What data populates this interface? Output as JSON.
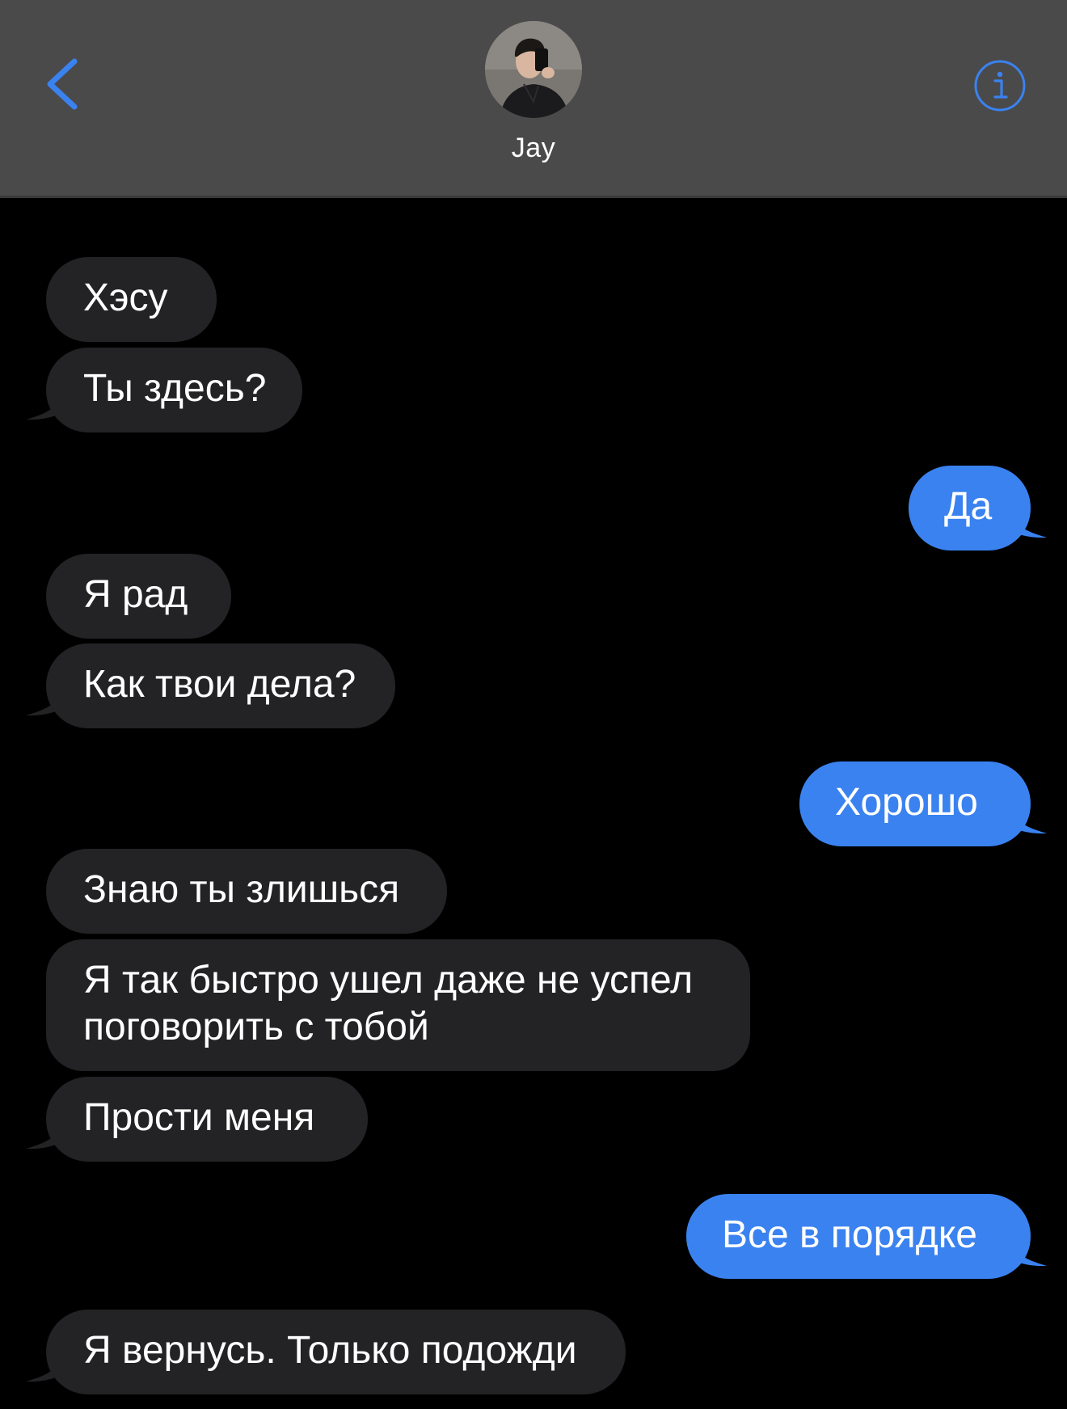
{
  "header": {
    "contact_name": "Jay",
    "back_icon": "chevron-left-icon",
    "info_icon": "info-circle-icon",
    "accent_color": "#3a82f0"
  },
  "messages": [
    {
      "direction": "incoming",
      "text": "Хэсу"
    },
    {
      "direction": "incoming",
      "text": "Ты здесь?"
    },
    {
      "direction": "outgoing",
      "text": "Да"
    },
    {
      "direction": "incoming",
      "text": "Я рад"
    },
    {
      "direction": "incoming",
      "text": "Как твои дела?"
    },
    {
      "direction": "outgoing",
      "text": "Хорошо"
    },
    {
      "direction": "incoming",
      "text": "Знаю ты злишься"
    },
    {
      "direction": "incoming",
      "text": "Я так быстро ушел даже не успел поговорить с тобой"
    },
    {
      "direction": "incoming",
      "text": "Прости меня"
    },
    {
      "direction": "outgoing",
      "text": "Все в порядке"
    },
    {
      "direction": "incoming",
      "text": "Я вернусь. Только подожди"
    }
  ],
  "colors": {
    "incoming_bubble": "#232325",
    "outgoing_bubble": "#3a82f0",
    "header_background": "#4a4a4a",
    "background": "#000000"
  }
}
